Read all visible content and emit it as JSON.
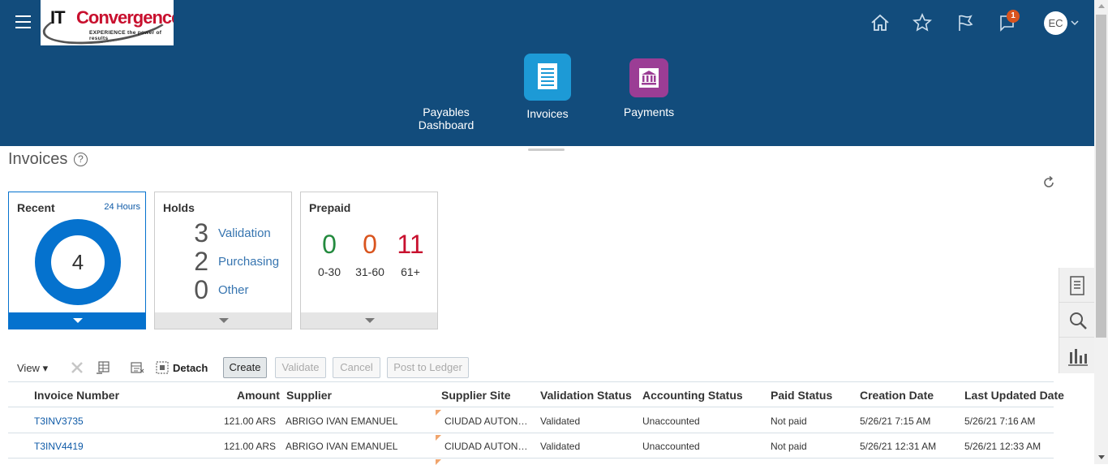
{
  "header": {
    "logo": {
      "brand_left": "IT",
      "brand_right": "Convergence",
      "tagline": "EXPERIENCE the power of results"
    },
    "icons": [
      "menu-icon",
      "home-icon",
      "star-icon",
      "flag-icon",
      "notifications-icon"
    ],
    "notifications_count": "1",
    "user_initials": "EC"
  },
  "apps": [
    {
      "label_line1": "Payables",
      "label_line2": "Dashboard"
    },
    {
      "label_line1": "Invoices",
      "label_line2": "",
      "color": "#1d9ad6"
    },
    {
      "label_line1": "Payments",
      "label_line2": "",
      "color": "#9b3d95"
    }
  ],
  "page": {
    "title": "Invoices",
    "help": "?"
  },
  "cards": {
    "recent": {
      "title": "Recent",
      "period": "24 Hours",
      "count": "4"
    },
    "holds": {
      "title": "Holds",
      "items": [
        {
          "count": "3",
          "label": "Validation"
        },
        {
          "count": "2",
          "label": "Purchasing"
        },
        {
          "count": "0",
          "label": "Other"
        }
      ]
    },
    "prepaid": {
      "title": "Prepaid",
      "buckets": [
        {
          "count": "0",
          "range": "0-30",
          "color": "#238a3e"
        },
        {
          "count": "0",
          "range": "31-60",
          "color": "#d9541e"
        },
        {
          "count": "11",
          "range": "61+",
          "color": "#c8102e"
        }
      ]
    }
  },
  "toolbar": {
    "view_label": "View",
    "detach_label": "Detach",
    "buttons": {
      "create": "Create",
      "validate": "Validate",
      "cancel": "Cancel",
      "post": "Post to Ledger"
    }
  },
  "table": {
    "columns": [
      "Invoice Number",
      "Amount",
      "Supplier",
      "Supplier Site",
      "Validation Status",
      "Accounting Status",
      "Paid Status",
      "Creation Date",
      "Last Updated Date"
    ],
    "rows": [
      {
        "invoice": "T3INV3735",
        "amount": "121.00 ARS",
        "supplier": "ABRIGO IVAN EMANUEL",
        "site": "CIUDAD AUTON…",
        "validation": "Validated",
        "accounting": "Unaccounted",
        "paid": "Not paid",
        "created": "5/26/21 7:15 AM",
        "updated": "5/26/21 7:16 AM"
      },
      {
        "invoice": "T3INV4419",
        "amount": "121.00 ARS",
        "supplier": "ABRIGO IVAN EMANUEL",
        "site": "CIUDAD AUTON…",
        "validation": "Validated",
        "accounting": "Unaccounted",
        "paid": "Not paid",
        "created": "5/26/21 12:31 AM",
        "updated": "5/26/21 12:33 AM"
      }
    ]
  },
  "side_panel": {
    "icons": [
      "tasks-icon",
      "search-icon",
      "reports-icon"
    ]
  }
}
